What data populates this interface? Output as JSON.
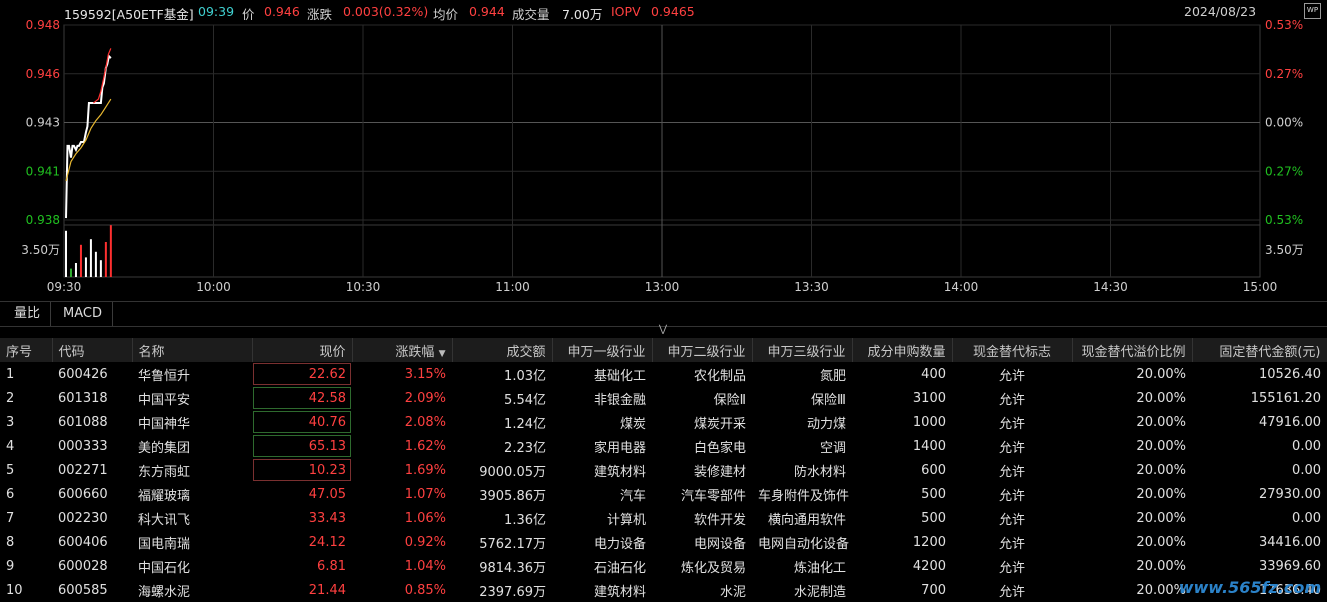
{
  "header": {
    "code_name": "159592[A50ETF基金]",
    "time": "09:39",
    "price_label": "价",
    "price": "0.946",
    "change_label": "涨跌",
    "change": "0.003(0.32%)",
    "avg_label": "均价",
    "avg": "0.944",
    "volume_label": "成交量",
    "volume": "7.00万",
    "iopv_label": "IOPV",
    "iopv": "0.9465",
    "date": "2024/08/23",
    "wp_icon": "WP"
  },
  "chart_data": {
    "type": "line",
    "y_left_ticks": [
      "0.948",
      "0.946",
      "0.943",
      "0.941",
      "0.938"
    ],
    "y_right_ticks": [
      "0.53%",
      "0.27%",
      "0.00%",
      "0.27%",
      "0.53%"
    ],
    "ylim": [
      0.938,
      0.948
    ],
    "volume_label": "3.50万",
    "volume_label_right": "3.50万",
    "x_ticks": [
      "09:30",
      "10:00",
      "10:30",
      "11:00",
      "13:00",
      "13:30",
      "14:00",
      "14:30",
      "15:00"
    ],
    "series": [
      {
        "color": "#ffffff",
        "x": [
          0,
          0.3,
          0.6,
          1,
          1.3,
          1.6,
          2,
          2.3,
          2.6,
          3,
          3.3,
          3.6,
          4,
          4.3,
          4.6,
          5,
          5.3,
          5.6,
          6,
          6.3,
          6.6,
          7,
          7.3,
          7.6,
          8,
          8.3,
          8.6,
          9
        ],
        "values": [
          0.9381,
          0.9418,
          0.9418,
          0.9412,
          0.9418,
          0.9418,
          0.9416,
          0.9418,
          0.9418,
          0.942,
          0.942,
          0.942,
          0.9425,
          0.9428,
          0.944,
          0.944,
          0.944,
          0.944,
          0.944,
          0.944,
          0.944,
          0.944,
          0.9448,
          0.945,
          0.9458,
          0.946,
          0.9464,
          0.9463
        ]
      },
      {
        "color": "#e8b830",
        "x": [
          0,
          1,
          2,
          3,
          4,
          5,
          6,
          7,
          8,
          9
        ],
        "values": [
          0.94,
          0.941,
          0.9414,
          0.9417,
          0.9421,
          0.9427,
          0.9431,
          0.9434,
          0.9438,
          0.9442
        ]
      },
      {
        "color": "#ff3030",
        "x": [
          5.5,
          6,
          6.5,
          7,
          7.5,
          8,
          8.5,
          9
        ],
        "values": [
          0.944,
          0.9441,
          0.9442,
          0.9446,
          0.9452,
          0.9458,
          0.9465,
          0.9468
        ]
      }
    ],
    "volumes": [
      {
        "x": 0,
        "v": 3.3,
        "c": "#ffffff"
      },
      {
        "x": 1,
        "v": 0.6,
        "c": "#30b030"
      },
      {
        "x": 2,
        "v": 1.0,
        "c": "#ffffff"
      },
      {
        "x": 3,
        "v": 2.3,
        "c": "#ff3030"
      },
      {
        "x": 4,
        "v": 1.4,
        "c": "#ffffff"
      },
      {
        "x": 5,
        "v": 2.7,
        "c": "#ffffff"
      },
      {
        "x": 6,
        "v": 1.8,
        "c": "#ffffff"
      },
      {
        "x": 7,
        "v": 1.2,
        "c": "#ffffff"
      },
      {
        "x": 8,
        "v": 2.5,
        "c": "#ff3030"
      },
      {
        "x": 9,
        "v": 3.7,
        "c": "#ff3030"
      }
    ]
  },
  "tabs": [
    "量比",
    "MACD"
  ],
  "collapse_icon": "double-chevron-down",
  "table": {
    "columns": [
      "序号",
      "代码",
      "名称",
      "现价",
      "涨跌幅",
      "成交额",
      "申万一级行业",
      "申万二级行业",
      "申万三级行业",
      "成分申购数量",
      "现金替代标志",
      "现金替代溢价比例",
      "固定替代金额(元)"
    ],
    "rows": [
      [
        "1",
        "600426",
        "华鲁恒升",
        "22.62",
        "3.15%",
        "1.03亿",
        "基础化工",
        "农化制品",
        "氮肥",
        "400",
        "允许",
        "20.00%",
        "10526.40"
      ],
      [
        "2",
        "601318",
        "中国平安",
        "42.58",
        "2.09%",
        "5.54亿",
        "非银金融",
        "保险Ⅱ",
        "保险Ⅲ",
        "3100",
        "允许",
        "20.00%",
        "155161.20"
      ],
      [
        "3",
        "601088",
        "中国神华",
        "40.76",
        "2.08%",
        "1.24亿",
        "煤炭",
        "煤炭开采",
        "动力煤",
        "1000",
        "允许",
        "20.00%",
        "47916.00"
      ],
      [
        "4",
        "000333",
        "美的集团",
        "65.13",
        "1.62%",
        "2.23亿",
        "家用电器",
        "白色家电",
        "空调",
        "1400",
        "允许",
        "20.00%",
        "0.00"
      ],
      [
        "5",
        "002271",
        "东方雨虹",
        "10.23",
        "1.69%",
        "9000.05万",
        "建筑材料",
        "装修建材",
        "防水材料",
        "600",
        "允许",
        "20.00%",
        "0.00"
      ],
      [
        "6",
        "600660",
        "福耀玻璃",
        "47.05",
        "1.07%",
        "3905.86万",
        "汽车",
        "汽车零部件",
        "车身附件及饰件",
        "500",
        "允许",
        "20.00%",
        "27930.00"
      ],
      [
        "7",
        "002230",
        "科大讯飞",
        "33.43",
        "1.06%",
        "1.36亿",
        "计算机",
        "软件开发",
        "横向通用软件",
        "500",
        "允许",
        "20.00%",
        "0.00"
      ],
      [
        "8",
        "600406",
        "国电南瑞",
        "24.12",
        "0.92%",
        "5762.17万",
        "电力设备",
        "电网设备",
        "电网自动化设备",
        "1200",
        "允许",
        "20.00%",
        "34416.00"
      ],
      [
        "9",
        "600028",
        "中国石化",
        "6.81",
        "1.04%",
        "9814.36万",
        "石油石化",
        "炼化及贸易",
        "炼油化工",
        "4200",
        "允许",
        "20.00%",
        "33969.60"
      ],
      [
        "10",
        "600585",
        "海螺水泥",
        "21.44",
        "0.85%",
        "2397.69万",
        "建筑材料",
        "水泥",
        "水泥制造",
        "700",
        "允许",
        "20.00%",
        "17636.40"
      ]
    ]
  },
  "watermark": "www.565fz.com"
}
